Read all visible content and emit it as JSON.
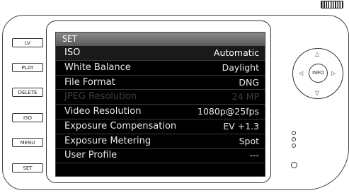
{
  "side_buttons": [
    "LV",
    "PLAY",
    "DELETE",
    "ISO",
    "MENU",
    "SET"
  ],
  "screen": {
    "title": "SET",
    "items": [
      {
        "label": "ISO",
        "value": "Automatic",
        "state": "selected"
      },
      {
        "label": "White Balance",
        "value": "Daylight",
        "state": "normal"
      },
      {
        "label": "File Format",
        "value": "DNG",
        "state": "normal"
      },
      {
        "label": "JPEG Resolution",
        "value": "24 MP",
        "state": "disabled"
      },
      {
        "label": "Video Resolution",
        "value": "1080p@25fps",
        "state": "normal"
      },
      {
        "label": "Exposure Compensation",
        "value": "EV +1.3",
        "state": "normal"
      },
      {
        "label": "Exposure Metering",
        "value": "Spot",
        "state": "normal"
      },
      {
        "label": "User Profile",
        "value": "---",
        "state": "normal"
      }
    ]
  },
  "dpad": {
    "center_label": "INFO",
    "up_arrow": "△",
    "down_arrow": "▽",
    "left_arrow": "◁",
    "right_arrow": "▷"
  },
  "battery_icon": "battery-icon"
}
